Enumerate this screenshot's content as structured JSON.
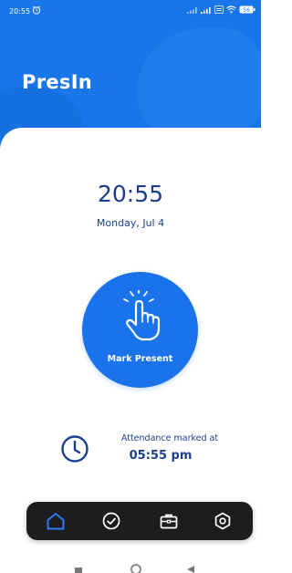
{
  "status_bar": {
    "time": "20:55",
    "battery_level": "56"
  },
  "app": {
    "title": "PresIn"
  },
  "clock": {
    "time": "20:55",
    "date": "Monday, Jul 4"
  },
  "mark_button": {
    "label": "Mark Present",
    "icon": "tap-hand-icon"
  },
  "attendance": {
    "label": "Attendance marked at",
    "time": "05:55 pm",
    "icon": "clock-icon"
  },
  "bottom_nav": {
    "items": [
      {
        "icon": "home-icon",
        "active": true
      },
      {
        "icon": "check-circle-icon",
        "active": false
      },
      {
        "icon": "briefcase-icon",
        "active": false
      },
      {
        "icon": "settings-icon",
        "active": false
      }
    ]
  },
  "colors": {
    "primary": "#1976e8",
    "button": "#1a73ea",
    "text_dark_blue": "#1b3f8f",
    "nav_background": "#1d1d1f",
    "nav_active": "#2f7cf0"
  }
}
